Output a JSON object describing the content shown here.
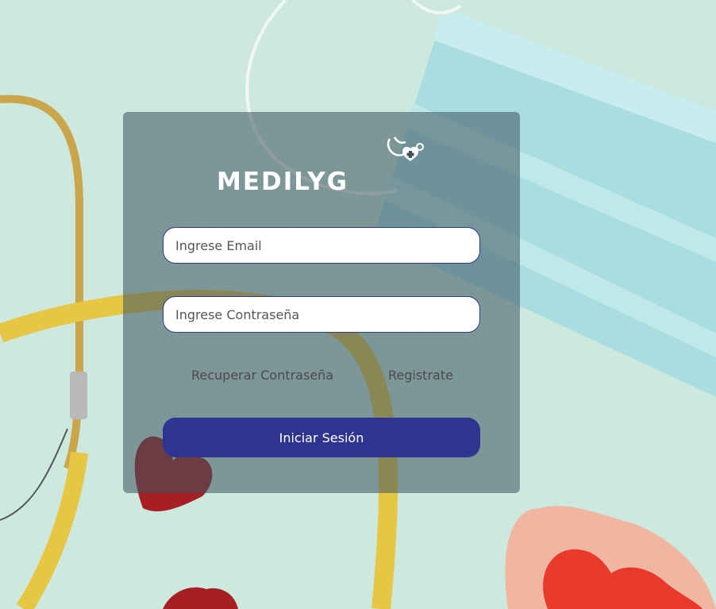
{
  "brand": {
    "name": "MEDILYG"
  },
  "form": {
    "email_placeholder": "Ingrese Email",
    "password_placeholder": "Ingrese Contraseña",
    "recover_label": "Recuperar Contraseña",
    "register_label": "Registrate",
    "submit_label": "Iniciar Sesión"
  },
  "colors": {
    "primary": "#2e3590",
    "input_border": "#2c3a8c"
  }
}
